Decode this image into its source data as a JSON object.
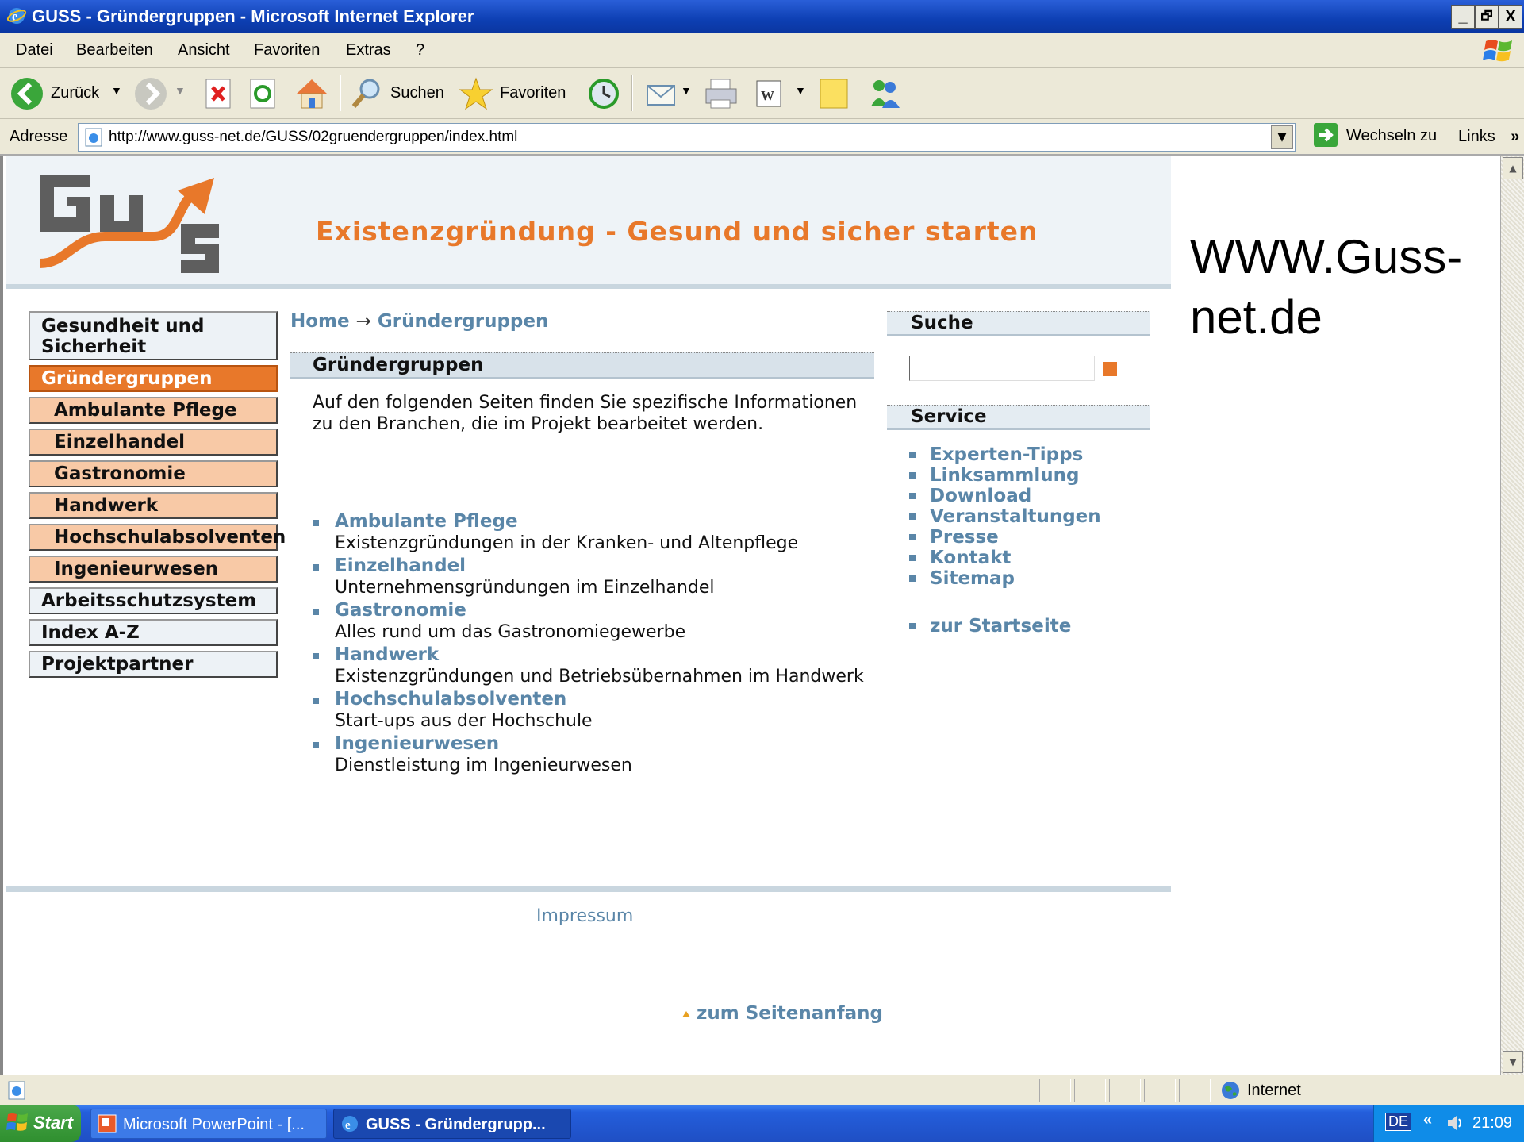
{
  "window": {
    "title": "GUSS - Gründergruppen - Microsoft Internet Explorer",
    "buttons": [
      "_",
      "🗗",
      "X"
    ]
  },
  "menu": [
    "Datei",
    "Bearbeiten",
    "Ansicht",
    "Favoriten",
    "Extras",
    "?"
  ],
  "toolbar": {
    "back": "Zurück",
    "search": "Suchen",
    "favorites": "Favoriten"
  },
  "address": {
    "label": "Adresse",
    "url": "http://www.guss-net.de/GUSS/02gruendergruppen/index.html",
    "go": "Wechseln zu",
    "links": "Links",
    "links_more": "»"
  },
  "site": {
    "slogan": "Existenzgründung - Gesund und sicher starten",
    "colors": {
      "orange": "#e8782a",
      "link": "#5a86a8",
      "nav_sub": "#f8c9a6"
    }
  },
  "overlay": {
    "line1": "WWW.Guss-",
    "line2": "net.de"
  },
  "nav": {
    "top": {
      "line1": "Gesundheit und",
      "line2": "Sicherheit"
    },
    "active": "Gründergruppen",
    "sub": [
      "Ambulante Pflege",
      "Einzelhandel",
      "Gastronomie",
      "Handwerk",
      "Hochschulabsolventen",
      "Ingenieurwesen"
    ],
    "rest": [
      "Arbeitsschutzsystem",
      "Index A-Z",
      "Projektpartner"
    ]
  },
  "breadcrumb": {
    "home": "Home",
    "sep": "→",
    "current": "Gründergruppen"
  },
  "content": {
    "heading": "Gründergruppen",
    "intro": "Auf den folgenden Seiten finden Sie spezifische Informationen zu den Branchen, die im Projekt bearbeitet werden.",
    "items": [
      {
        "title": "Ambulante Pflege",
        "desc": "Existenzgründungen in der Kranken- und Altenpflege"
      },
      {
        "title": "Einzelhandel",
        "desc": "Unternehmensgründungen im Einzelhandel"
      },
      {
        "title": "Gastronomie",
        "desc": "Alles rund um das Gastronomiegewerbe"
      },
      {
        "title": "Handwerk",
        "desc": "Existenzgründungen und Betriebsübernahmen im Handwerk"
      },
      {
        "title": "Hochschulabsolventen",
        "desc": "Start-ups aus der Hochschule"
      },
      {
        "title": "Ingenieurwesen",
        "desc": "Dienstleistung im Ingenieurwesen"
      }
    ],
    "to_top": "zum Seitenanfang"
  },
  "sidebar": {
    "search_title": "Suche",
    "search_value": "",
    "service_title": "Service",
    "service": [
      "Experten-Tipps",
      "Linksammlung",
      "Download",
      "Veranstaltungen",
      "Presse",
      "Kontakt",
      "Sitemap"
    ],
    "home_link": "zur Startseite"
  },
  "footer": {
    "impressum": "Impressum"
  },
  "status": {
    "zone": "Internet"
  },
  "taskbar": {
    "start": "Start",
    "tasks": [
      "Microsoft PowerPoint - [...",
      "GUSS - Gründergrupp..."
    ],
    "lang": "DE",
    "chevron": "«",
    "clock": "21:09"
  }
}
